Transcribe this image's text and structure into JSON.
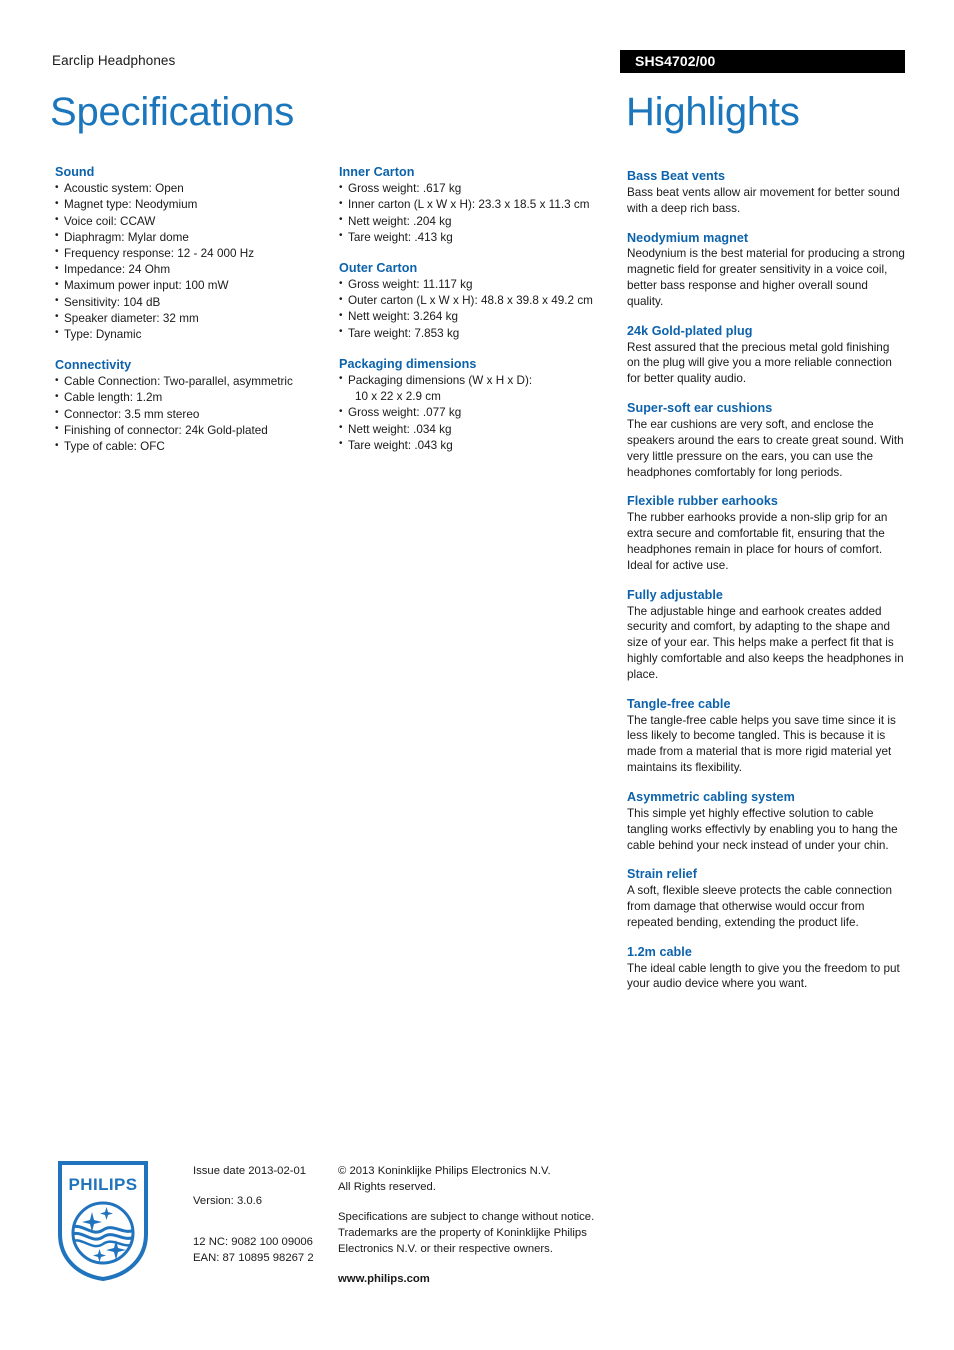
{
  "header": {
    "product_family": "Earclip Headphones",
    "model_code": "SHS4702/00"
  },
  "titles": {
    "specifications": "Specifications",
    "highlights": "Highlights"
  },
  "colors": {
    "heading_blue": "#0c62ab",
    "title_blue": "#1b76bc",
    "banner_black": "#000000",
    "logo_blue": "#2073bd"
  },
  "specifications": {
    "column_1": [
      {
        "heading": "Sound",
        "items": [
          "Acoustic system: Open",
          "Magnet type: Neodymium",
          "Voice coil: CCAW",
          "Diaphragm: Mylar dome",
          "Frequency response: 12 - 24 000 Hz",
          "Impedance: 24 Ohm",
          "Maximum power input: 100 mW",
          "Sensitivity: 104 dB",
          "Speaker diameter: 32 mm",
          "Type: Dynamic"
        ]
      },
      {
        "heading": "Connectivity",
        "items": [
          "Cable Connection: Two-parallel, asymmetric",
          "Cable length: 1.2m",
          "Connector: 3.5 mm stereo",
          "Finishing of connector: 24k Gold-plated",
          "Type of cable: OFC"
        ]
      }
    ],
    "column_2": [
      {
        "heading": "Inner Carton",
        "items": [
          "Gross weight: .617 kg",
          "Inner carton (L x W x H): 23.3 x 18.5 x 11.3 cm",
          "Nett weight: .204 kg",
          "Tare weight: .413 kg"
        ]
      },
      {
        "heading": "Outer Carton",
        "items": [
          "Gross weight: 11.117 kg",
          "Outer carton (L x W x H): 48.8 x 39.8 x 49.2 cm",
          "Nett weight: 3.264 kg",
          "Tare weight: 7.853 kg"
        ]
      },
      {
        "heading": "Packaging dimensions",
        "items": [
          "Packaging dimensions (W x H x D):",
          "Gross weight: .077 kg",
          "Nett weight: .034 kg",
          "Tare weight: .043 kg"
        ],
        "item_0_continuation": "10 x 22 x 2.9 cm"
      }
    ]
  },
  "highlights": [
    {
      "heading": "Bass Beat vents",
      "body": "Bass beat vents allow air movement for better sound with a deep rich bass."
    },
    {
      "heading": "Neodymium magnet",
      "body": "Neodynium is the best material for producing a strong magnetic field for greater sensitivity in a voice coil, better bass response and higher overall sound quality."
    },
    {
      "heading": "24k Gold-plated plug",
      "body": "Rest assured that the precious metal gold finishing on the plug will give you a more reliable connection for better quality audio."
    },
    {
      "heading": "Super-soft ear cushions",
      "body": "The ear cushions are very soft, and enclose the speakers around the ears to create great sound. With very little pressure on the ears, you can use the headphones comfortably for long periods."
    },
    {
      "heading": "Flexible rubber earhooks",
      "body": "The rubber earhooks provide a non-slip grip for an extra secure and comfortable fit, ensuring that the headphones remain in place for hours of comfort. Ideal for active use."
    },
    {
      "heading": "Fully adjustable",
      "body": "The adjustable hinge and earhook creates added security and comfort, by adapting to the shape and size of your ear. This helps make a perfect fit that is highly comfortable and also keeps the headphones in place."
    },
    {
      "heading": "Tangle-free cable",
      "body": "The tangle-free cable helps you save time since it is less likely to become tangled. This is because it is made from a material that is more rigid material yet maintains its flexibility."
    },
    {
      "heading": "Asymmetric cabling system",
      "body": "This simple yet highly effective solution to cable tangling works effectivly by enabling you to hang the cable behind your neck instead of under your chin."
    },
    {
      "heading": "Strain relief",
      "body": "A soft, flexible sleeve protects the cable connection from damage that otherwise would occur from repeated bending, extending the product life."
    },
    {
      "heading": "1.2m cable",
      "body": "The ideal cable length to give you the freedom to put your audio device where you want."
    }
  ],
  "footer": {
    "logo_wordmark": "PHILIPS",
    "issue_date": "Issue date 2013-02-01",
    "version": "Version: 3.0.6",
    "nc_code": "12 NC: 9082 100 09006",
    "ean_code": "EAN: 87 10895 98267 2",
    "copyright_line_1": "© 2013 Koninklijke Philips Electronics N.V.",
    "copyright_line_2": "All Rights reserved.",
    "disclaimer_line_1": "Specifications are subject to change without notice.",
    "disclaimer_line_2": "Trademarks are the property of Koninklijke Philips",
    "disclaimer_line_3": "Electronics N.V. or their respective owners.",
    "website": "www.philips.com"
  }
}
